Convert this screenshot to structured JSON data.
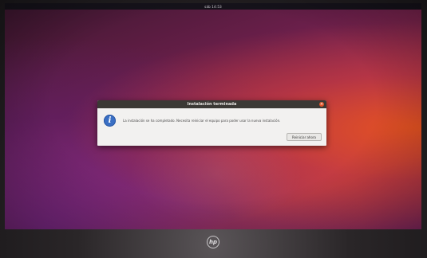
{
  "topbar": {
    "clock": "sáb 14:53"
  },
  "dialog": {
    "title": "Instalación terminada",
    "close_glyph": "×",
    "message": "La instalación se ha completado. Necesita reiniciar el equipo para poder usar la nueva instalación.",
    "restart_label": "Reiniciar ahora",
    "icon": "info-icon"
  },
  "hardware": {
    "logo_text": "hp"
  },
  "colors": {
    "dialog_bg": "#f2f1f0",
    "titlebar_bg": "#3b3935",
    "info_blue": "#3a6fc4",
    "close_orange": "#e0552b"
  }
}
